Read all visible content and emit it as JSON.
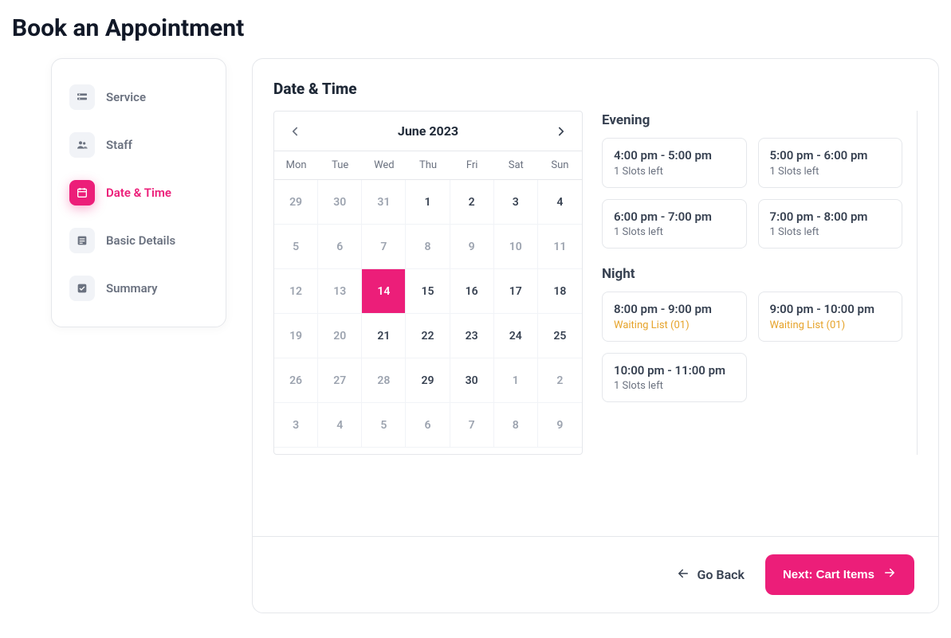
{
  "page_title": "Book an Appointment",
  "sidebar": {
    "items": [
      {
        "label": "Service",
        "icon": "service-icon",
        "active": false
      },
      {
        "label": "Staff",
        "icon": "staff-icon",
        "active": false
      },
      {
        "label": "Date & Time",
        "icon": "calendar-icon",
        "active": true
      },
      {
        "label": "Basic Details",
        "icon": "details-icon",
        "active": false
      },
      {
        "label": "Summary",
        "icon": "summary-icon",
        "active": false
      }
    ]
  },
  "main": {
    "section_title": "Date & Time",
    "calendar": {
      "month_label": "June 2023",
      "weekdays": [
        "Mon",
        "Tue",
        "Wed",
        "Thu",
        "Fri",
        "Sat",
        "Sun"
      ],
      "weeks": [
        [
          {
            "day": "29",
            "muted": true
          },
          {
            "day": "30",
            "muted": true
          },
          {
            "day": "31",
            "muted": true
          },
          {
            "day": "1"
          },
          {
            "day": "2"
          },
          {
            "day": "3"
          },
          {
            "day": "4"
          }
        ],
        [
          {
            "day": "5",
            "muted": true
          },
          {
            "day": "6",
            "muted": true
          },
          {
            "day": "7",
            "muted": true
          },
          {
            "day": "8",
            "muted": true
          },
          {
            "day": "9",
            "muted": true
          },
          {
            "day": "10",
            "muted": true
          },
          {
            "day": "11",
            "muted": true
          }
        ],
        [
          {
            "day": "12",
            "muted": true
          },
          {
            "day": "13",
            "muted": true
          },
          {
            "day": "14",
            "selected": true
          },
          {
            "day": "15"
          },
          {
            "day": "16"
          },
          {
            "day": "17"
          },
          {
            "day": "18"
          }
        ],
        [
          {
            "day": "19",
            "muted": true
          },
          {
            "day": "20",
            "muted": true
          },
          {
            "day": "21"
          },
          {
            "day": "22"
          },
          {
            "day": "23"
          },
          {
            "day": "24"
          },
          {
            "day": "25"
          }
        ],
        [
          {
            "day": "26",
            "muted": true
          },
          {
            "day": "27",
            "muted": true
          },
          {
            "day": "28",
            "muted": true
          },
          {
            "day": "29"
          },
          {
            "day": "30"
          },
          {
            "day": "1",
            "muted": true
          },
          {
            "day": "2",
            "muted": true
          }
        ],
        [
          {
            "day": "3",
            "muted": true
          },
          {
            "day": "4",
            "muted": true
          },
          {
            "day": "5",
            "muted": true
          },
          {
            "day": "6",
            "muted": true
          },
          {
            "day": "7",
            "muted": true
          },
          {
            "day": "8",
            "muted": true
          },
          {
            "day": "9",
            "muted": true
          }
        ]
      ]
    },
    "slot_groups": [
      {
        "title": "Evening",
        "slots": [
          {
            "time": "4:00 pm - 5:00 pm",
            "status": "1 Slots left",
            "waiting": false
          },
          {
            "time": "5:00 pm - 6:00 pm",
            "status": "1 Slots left",
            "waiting": false
          },
          {
            "time": "6:00 pm - 7:00 pm",
            "status": "1 Slots left",
            "waiting": false
          },
          {
            "time": "7:00 pm - 8:00 pm",
            "status": "1 Slots left",
            "waiting": false
          }
        ]
      },
      {
        "title": "Night",
        "slots": [
          {
            "time": "8:00 pm - 9:00 pm",
            "status": "Waiting List (01)",
            "waiting": true
          },
          {
            "time": "9:00 pm - 10:00 pm",
            "status": "Waiting List (01)",
            "waiting": true
          },
          {
            "time": "10:00 pm - 11:00 pm",
            "status": "1 Slots left",
            "waiting": false
          }
        ]
      }
    ]
  },
  "footer": {
    "go_back_label": "Go Back",
    "next_label": "Next: Cart Items"
  },
  "colors": {
    "accent": "#ec1e79",
    "warn": "#e6a32a"
  }
}
